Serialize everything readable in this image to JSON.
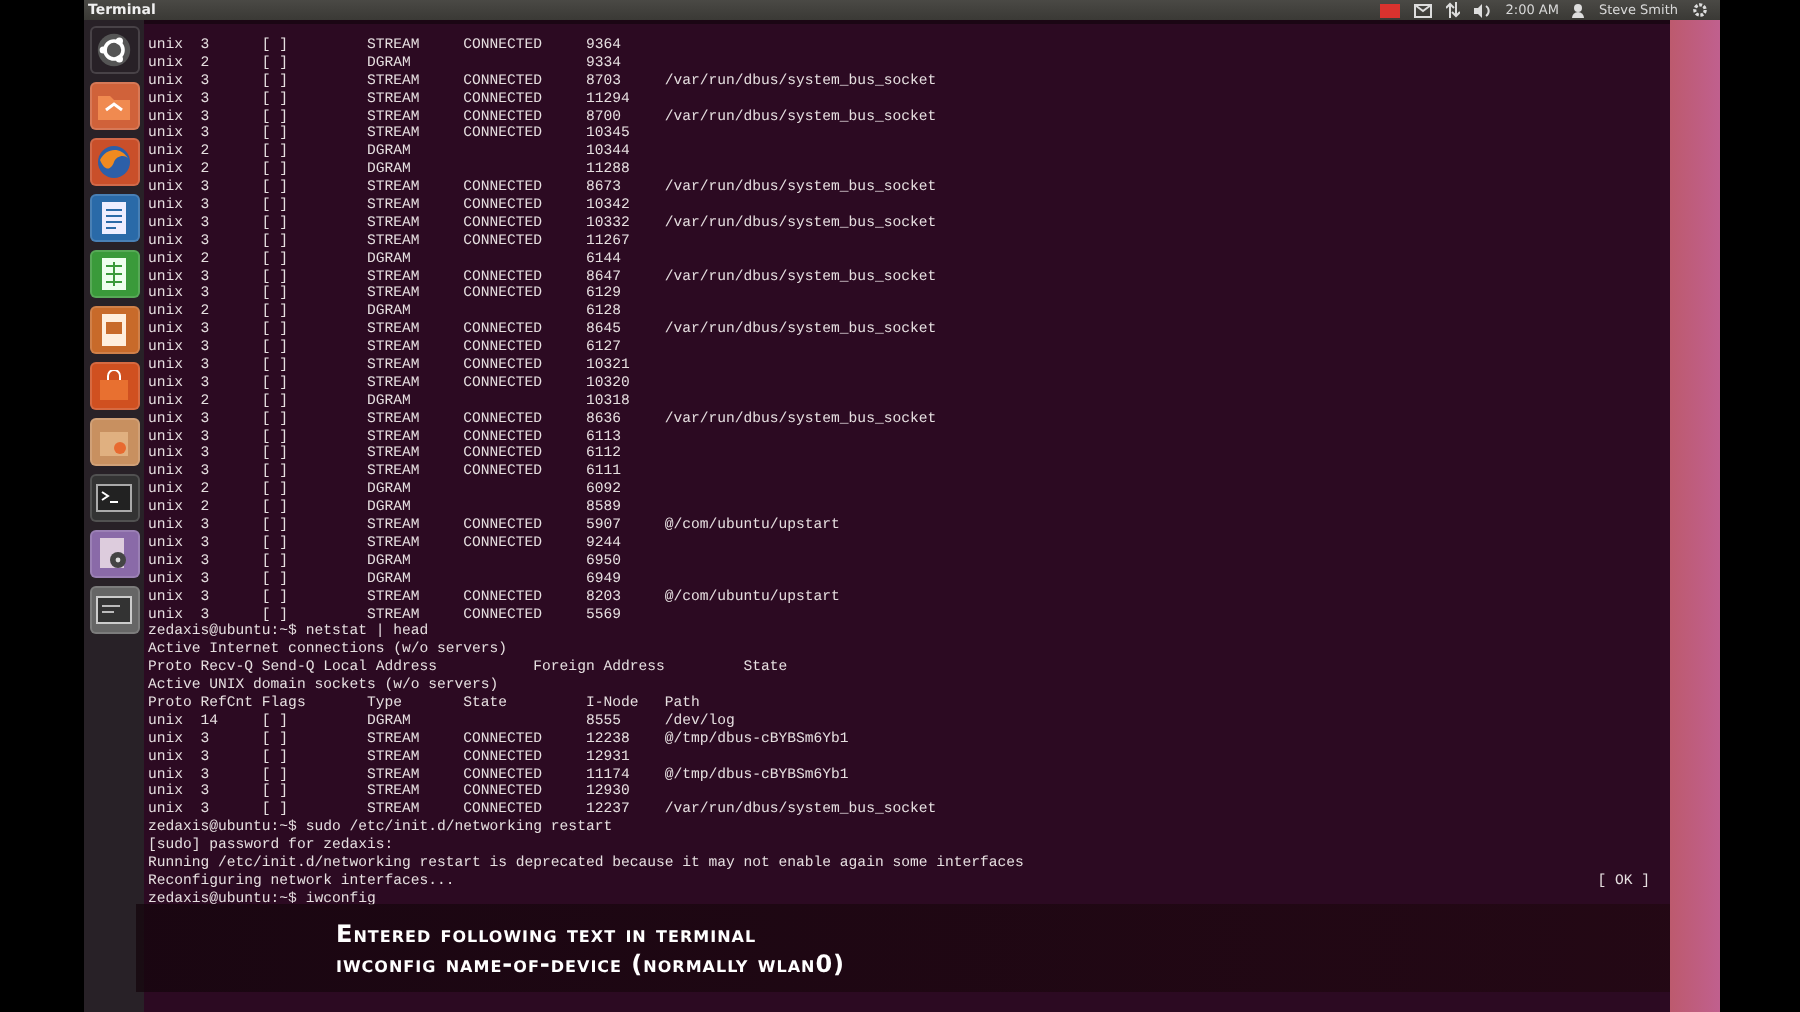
{
  "top_panel": {
    "app_title": "Terminal",
    "clock": "2:00 AM",
    "user": "Steve Smith"
  },
  "launcher": {
    "items": [
      {
        "kind": "ubuntu"
      },
      {
        "kind": "folder"
      },
      {
        "kind": "globe"
      },
      {
        "kind": "document"
      },
      {
        "kind": "spreadsheet"
      },
      {
        "kind": "presentation"
      },
      {
        "kind": "bag"
      },
      {
        "kind": "package"
      },
      {
        "kind": "terminal"
      },
      {
        "kind": "disc"
      },
      {
        "kind": "screen"
      }
    ]
  },
  "terminal": {
    "lines": [
      {
        "text": "unix  3      [ ]         STREAM     CONNECTED     9364"
      },
      {
        "text": "unix  2      [ ]         DGRAM                    9334"
      },
      {
        "text": "unix  3      [ ]         STREAM     CONNECTED     8703     /var/run/dbus/system_bus_socket"
      },
      {
        "text": "unix  3      [ ]         STREAM     CONNECTED     11294"
      },
      {
        "text": "unix  3      [ ]         STREAM     CONNECTED     8700     /var/run/dbus/system_bus_socket"
      },
      {
        "text": "unix  3      [ ]         STREAM     CONNECTED     10345"
      },
      {
        "text": "unix  2      [ ]         DGRAM                    10344"
      },
      {
        "text": "unix  2      [ ]         DGRAM                    11288"
      },
      {
        "text": "unix  3      [ ]         STREAM     CONNECTED     8673     /var/run/dbus/system_bus_socket"
      },
      {
        "text": "unix  3      [ ]         STREAM     CONNECTED     10342"
      },
      {
        "text": "unix  3      [ ]         STREAM     CONNECTED     10332    /var/run/dbus/system_bus_socket"
      },
      {
        "text": "unix  3      [ ]         STREAM     CONNECTED     11267"
      },
      {
        "text": "unix  2      [ ]         DGRAM                    6144"
      },
      {
        "text": "unix  3      [ ]         STREAM     CONNECTED     8647     /var/run/dbus/system_bus_socket"
      },
      {
        "text": "unix  3      [ ]         STREAM     CONNECTED     6129"
      },
      {
        "text": "unix  2      [ ]         DGRAM                    6128"
      },
      {
        "text": "unix  3      [ ]         STREAM     CONNECTED     8645     /var/run/dbus/system_bus_socket"
      },
      {
        "text": "unix  3      [ ]         STREAM     CONNECTED     6127"
      },
      {
        "text": "unix  3      [ ]         STREAM     CONNECTED     10321"
      },
      {
        "text": "unix  3      [ ]         STREAM     CONNECTED     10320"
      },
      {
        "text": "unix  2      [ ]         DGRAM                    10318"
      },
      {
        "text": "unix  3      [ ]         STREAM     CONNECTED     8636     /var/run/dbus/system_bus_socket"
      },
      {
        "text": "unix  3      [ ]         STREAM     CONNECTED     6113"
      },
      {
        "text": "unix  3      [ ]         STREAM     CONNECTED     6112"
      },
      {
        "text": "unix  3      [ ]         STREAM     CONNECTED     6111"
      },
      {
        "text": "unix  2      [ ]         DGRAM                    6092"
      },
      {
        "text": "unix  2      [ ]         DGRAM                    8589"
      },
      {
        "text": "unix  3      [ ]         STREAM     CONNECTED     5907     @/com/ubuntu/upstart"
      },
      {
        "text": "unix  3      [ ]         STREAM     CONNECTED     9244"
      },
      {
        "text": "unix  3      [ ]         DGRAM                    6950"
      },
      {
        "text": "unix  3      [ ]         DGRAM                    6949"
      },
      {
        "text": "unix  3      [ ]         STREAM     CONNECTED     8203     @/com/ubuntu/upstart"
      },
      {
        "text": "unix  3      [ ]         STREAM     CONNECTED     5569"
      },
      {
        "text": "zedaxis@ubuntu:~$ netstat | head"
      },
      {
        "text": "Active Internet connections (w/o servers)"
      },
      {
        "text": "Proto Recv-Q Send-Q Local Address           Foreign Address         State"
      },
      {
        "text": "Active UNIX domain sockets (w/o servers)"
      },
      {
        "text": "Proto RefCnt Flags       Type       State         I-Node   Path"
      },
      {
        "text": "unix  14     [ ]         DGRAM                    8555     /dev/log"
      },
      {
        "text": "unix  3      [ ]         STREAM     CONNECTED     12238    @/tmp/dbus-cBYBSm6Yb1"
      },
      {
        "text": "unix  3      [ ]         STREAM     CONNECTED     12931"
      },
      {
        "text": "unix  3      [ ]         STREAM     CONNECTED     11174    @/tmp/dbus-cBYBSm6Yb1"
      },
      {
        "text": "unix  3      [ ]         STREAM     CONNECTED     12930"
      },
      {
        "text": "unix  3      [ ]         STREAM     CONNECTED     12237    /var/run/dbus/system_bus_socket"
      },
      {
        "text": "zedaxis@ubuntu:~$ sudo /etc/init.d/networking restart"
      },
      {
        "text": "[sudo] password for zedaxis:"
      },
      {
        "text": "Running /etc/init.d/networking restart is deprecated because it may not enable again some interfaces"
      },
      {
        "text": "Reconfiguring network interfaces...",
        "status": "[ OK ]"
      },
      {
        "text": "zedaxis@ubuntu:~$ iwconfig"
      }
    ]
  },
  "caption": {
    "lines": [
      "Entered following text in terminal",
      "iwconfig name-of-device (normally wlan0)"
    ]
  }
}
